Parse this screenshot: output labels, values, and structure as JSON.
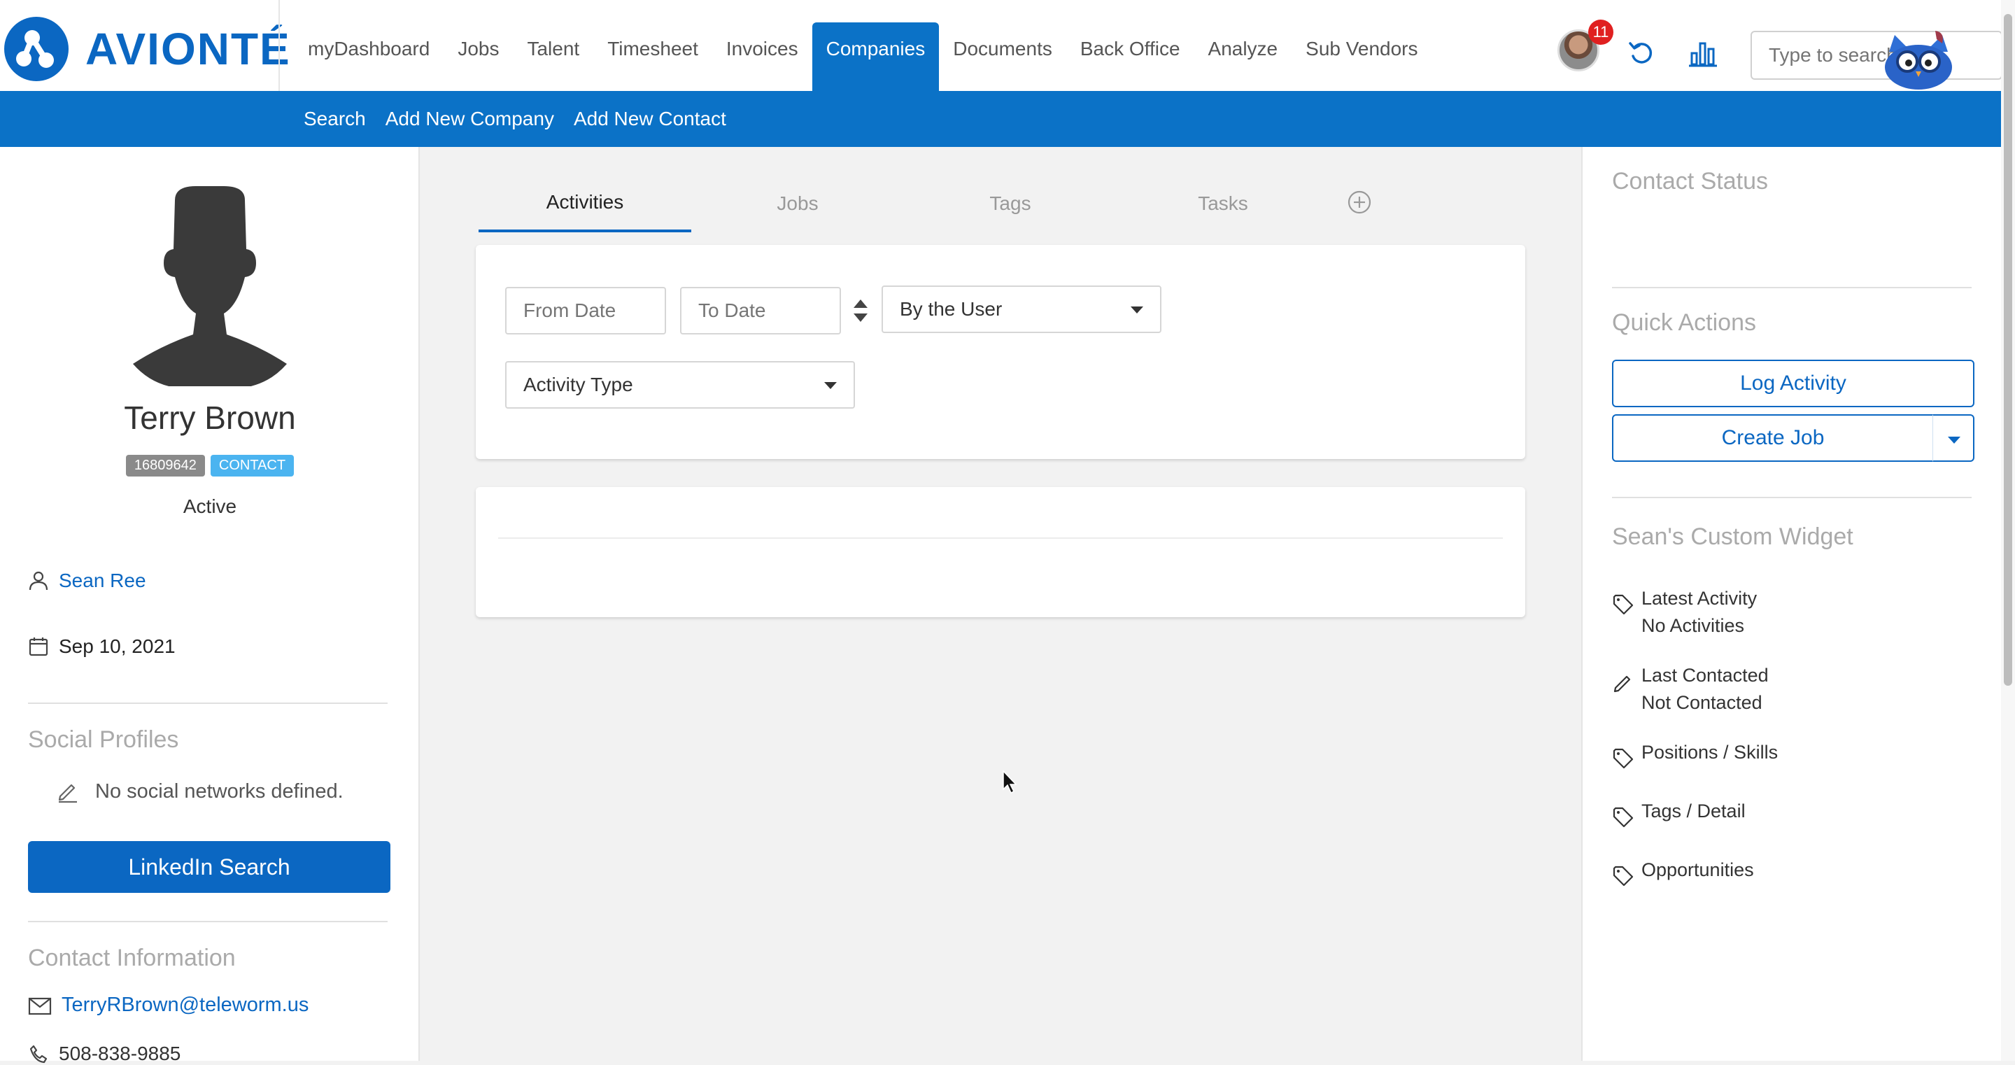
{
  "app": {
    "logo_text": "AVIONTÉ",
    "notifications_count": "11",
    "search_placeholder": "Type to search"
  },
  "nav": {
    "items": [
      "myDashboard",
      "Jobs",
      "Talent",
      "Timesheet",
      "Invoices",
      "Companies",
      "Documents",
      "Back Office",
      "Analyze",
      "Sub Vendors"
    ],
    "active": "Companies"
  },
  "subnav": {
    "items": [
      "Search",
      "Add New Company",
      "Add New Contact"
    ]
  },
  "contact": {
    "name": "Terry Brown",
    "id_badge": "16809642",
    "type_badge": "CONTACT",
    "status": "Active",
    "owner": "Sean Ree",
    "date": "Sep 10, 2021",
    "social_title": "Social Profiles",
    "social_empty": "No social networks defined.",
    "linkedin_button": "LinkedIn Search",
    "contact_info_title": "Contact Information",
    "email": "TerryRBrown@teleworm.us",
    "phone": "508-838-9885"
  },
  "center": {
    "tabs": [
      "Activities",
      "Jobs",
      "Tags",
      "Tasks"
    ],
    "active_tab": "Activities",
    "from_date_placeholder": "From Date",
    "to_date_placeholder": "To Date",
    "user_select_value": "By the User",
    "activity_type_value": "Activity Type"
  },
  "right": {
    "contact_status_title": "Contact Status",
    "quick_actions_title": "Quick Actions",
    "log_activity_button": "Log Activity",
    "create_job_button": "Create Job",
    "widget_title": "Sean's Custom Widget",
    "latest_activity_label": "Latest Activity",
    "latest_activity_value": "No Activities",
    "last_contacted_label": "Last Contacted",
    "last_contacted_value": "Not Contacted",
    "positions_label": "Positions / Skills",
    "tags_label": "Tags / Detail",
    "opportunities_label": "Opportunities"
  },
  "colors": {
    "brand_blue": "#0b67c2",
    "nav_blue": "#0b72c7",
    "badge_red": "#e02020",
    "badge_contact": "#4bb4f0",
    "badge_id": "#8a8a8a"
  }
}
